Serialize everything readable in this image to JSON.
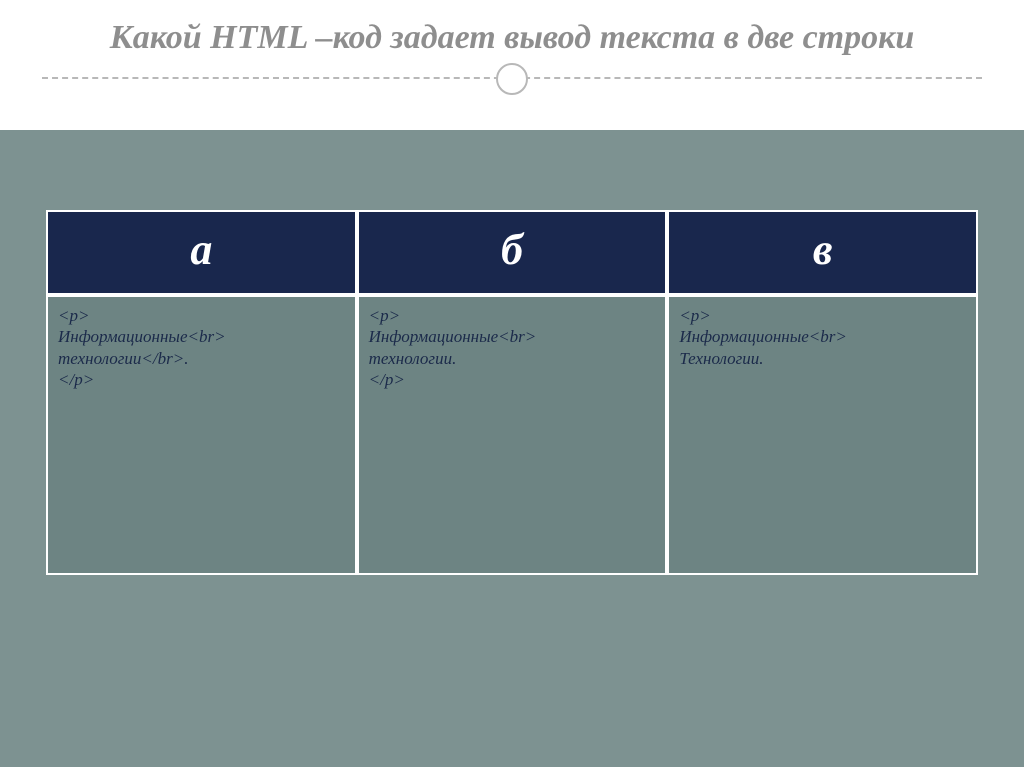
{
  "title": "Какой HTML –код задает вывод текста в две строки",
  "table": {
    "headers": [
      "а",
      "б",
      "в"
    ],
    "cells": [
      {
        "lines": [
          "<p>",
          "Информационные<br>",
          "технологии</br>.",
          "</p>"
        ]
      },
      {
        "lines": [
          "<p>",
          "Информационные<br>",
          "технологии.",
          "</p>"
        ]
      },
      {
        "lines": [
          "<p>",
          "Информационные<br>",
          "Технологии."
        ]
      }
    ]
  }
}
